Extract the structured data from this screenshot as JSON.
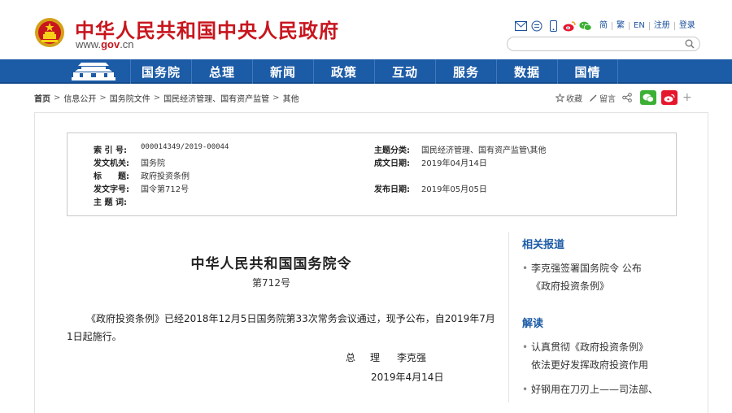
{
  "header": {
    "site_name": "中华人民共和国中央人民政府",
    "domain_prefix": "www.",
    "domain_main": "gov",
    "domain_suffix": ".cn",
    "links": [
      "简",
      "繁",
      "EN",
      "注册",
      "登录"
    ],
    "brand_color": "#c8161e"
  },
  "nav": {
    "items": [
      "国务院",
      "总理",
      "新闻",
      "政策",
      "互动",
      "服务",
      "数据",
      "国情"
    ],
    "bg_color": "#1c5ba6"
  },
  "breadcrumb": [
    "首页",
    "信息公开",
    "国务院文件",
    "国民经济管理、国有资产监管",
    "其他"
  ],
  "share": {
    "favorite": "收藏",
    "comment": "留言"
  },
  "info": {
    "index_label": "索 引 号:",
    "index_value": "000014349/2019-00044",
    "agency_label": "发文机关:",
    "agency_value": "国务院",
    "title_label": "标　　题:",
    "title_value": "政府投资条例",
    "docno_label": "发文字号:",
    "docno_value": "国令第712号",
    "keywords_label": "主 题 词:",
    "keywords_value": "",
    "subject_label": "主题分类:",
    "subject_value": "国民经济管理、国有资产监管\\其他",
    "created_label": "成文日期:",
    "created_value": "2019年04月14日",
    "published_label": "发布日期:",
    "published_value": "2019年05月05日"
  },
  "document": {
    "title": "中华人民共和国国务院令",
    "number": "第712号",
    "body": "《政府投资条例》已经2018年12月5日国务院第33次常务会议通过，现予公布，自2019年7月1日起施行。",
    "sign_title": "总　理",
    "sign_name": "李克强",
    "sign_date": "2019年4月14日"
  },
  "sidebar": {
    "related_title": "相关报道",
    "related_items": [
      "李克强签署国务院令 公布",
      "《政府投资条例》"
    ],
    "interpret_title": "解读",
    "interpret_items": [
      "认真贯彻《政府投资条例》",
      "依法更好发挥政府投资作用",
      "好钢用在刀刃上——司法部、"
    ]
  }
}
